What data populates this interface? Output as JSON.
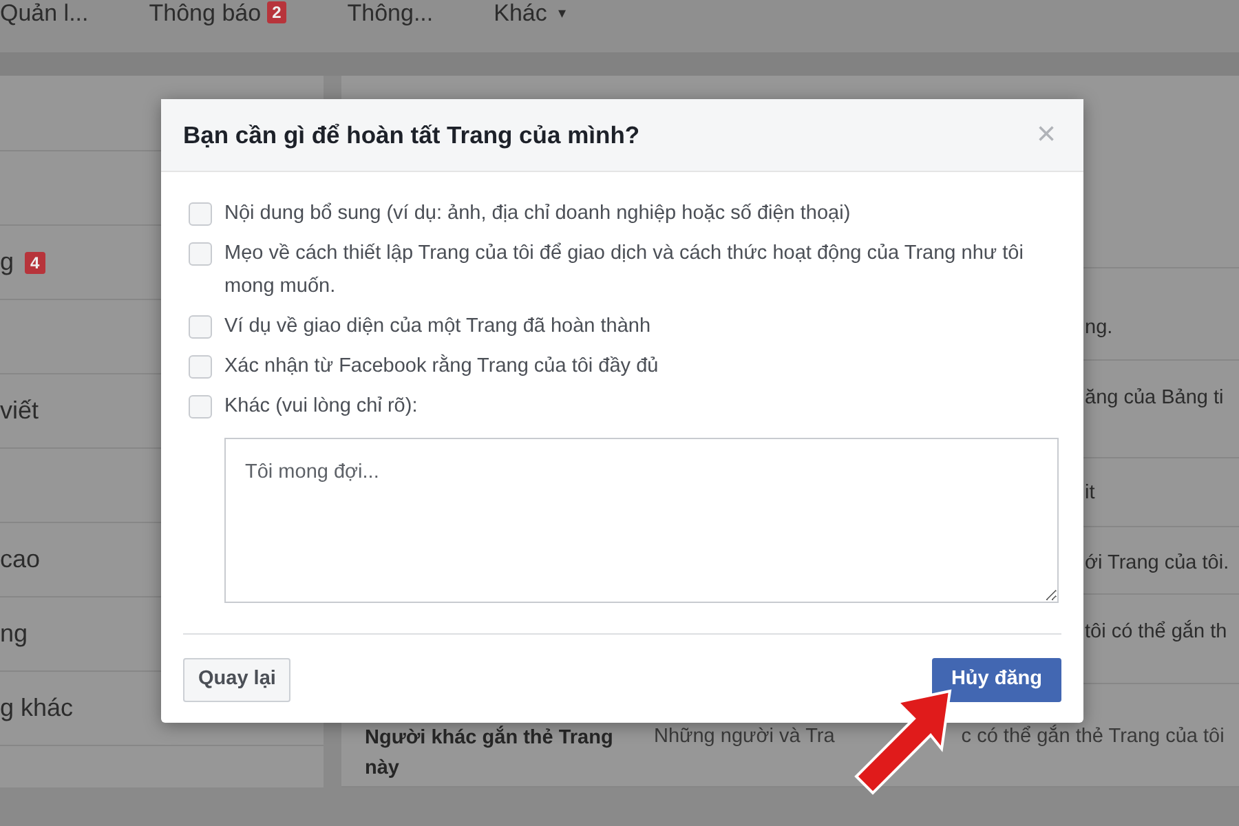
{
  "top_nav": [
    {
      "label": "Quản l..."
    },
    {
      "label": "Thông báo",
      "badge": "2"
    },
    {
      "label": "Thông..."
    },
    {
      "label": "Khác",
      "caret": "▾"
    }
  ],
  "sidebar": {
    "items": [
      {
        "kind": "blank"
      },
      {
        "kind": "blank"
      },
      {
        "kind": "text",
        "label": "g",
        "badge": "4"
      },
      {
        "kind": "blank"
      },
      {
        "kind": "text",
        "label": "viết"
      },
      {
        "kind": "blank"
      },
      {
        "kind": "text",
        "label": "cao"
      },
      {
        "kind": "text",
        "label": "ng"
      },
      {
        "kind": "text",
        "label": "g khác"
      }
    ]
  },
  "settings": {
    "rows": [
      {
        "kind": "blank"
      },
      {
        "kind": "fragment",
        "text": "ng."
      },
      {
        "kind": "fragment",
        "text": "ăng của Bảng ti"
      },
      {
        "kind": "fragment",
        "text": "it"
      },
      {
        "kind": "fragment",
        "text": "ới Trang của tôi."
      },
      {
        "kind": "fragment",
        "text": "tôi có thể gắn th"
      },
      {
        "kind": "full",
        "label": "Người khác gắn thẻ Trang này",
        "description_parts": [
          "Những người và Tra",
          "c có thể gắn thẻ Trang của tôi"
        ]
      }
    ]
  },
  "dialog": {
    "title": "Bạn cần gì để hoàn tất Trang của mình?",
    "close": "×",
    "options": [
      {
        "label": "Nội dung bổ sung (ví dụ: ảnh, địa chỉ doanh nghiệp hoặc số điện thoại)",
        "checked": false
      },
      {
        "label": "Mẹo về cách thiết lập Trang của tôi để giao dịch và cách thức hoạt động của Trang như tôi mong muốn.",
        "checked": false
      },
      {
        "label": "Ví dụ về giao diện của một Trang đã hoàn thành",
        "checked": false
      },
      {
        "label": "Xác nhận từ Facebook rằng Trang của tôi đầy đủ",
        "checked": false
      },
      {
        "label": "Khác (vui lòng chỉ rõ):",
        "checked": false
      }
    ],
    "textarea": {
      "placeholder": "Tôi mong đợi..."
    },
    "buttons": [
      {
        "label": "Quay lại",
        "kind": "secondary"
      },
      {
        "label": "Hủy đăng",
        "kind": "primary"
      }
    ]
  },
  "annotation": {
    "kind": "arrow"
  }
}
